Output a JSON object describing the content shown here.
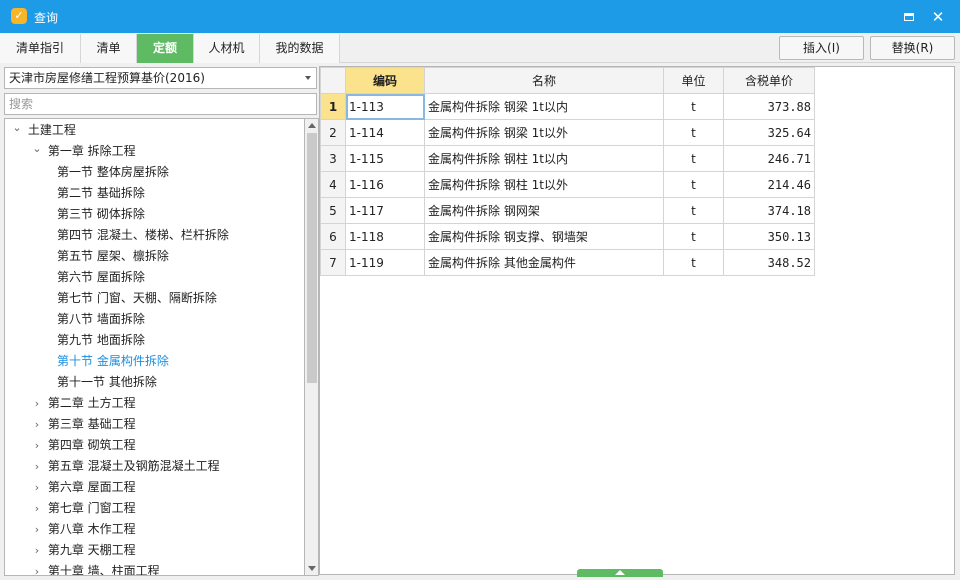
{
  "window": {
    "title": "查询"
  },
  "tabs": [
    {
      "label": "清单指引"
    },
    {
      "label": "清单"
    },
    {
      "label": "定额"
    },
    {
      "label": "人材机"
    },
    {
      "label": "我的数据"
    }
  ],
  "actions": {
    "insert": "插入(I)",
    "replace": "替换(R)"
  },
  "library": {
    "selected": "天津市房屋修缮工程预算基价(2016)"
  },
  "search": {
    "placeholder": "搜索",
    "value": ""
  },
  "tree": [
    {
      "label": "土建工程",
      "level": 0,
      "expander": "open"
    },
    {
      "label": "第一章 拆除工程",
      "level": 1,
      "expander": "open"
    },
    {
      "label": "第一节 整体房屋拆除",
      "level": 2
    },
    {
      "label": "第二节 基础拆除",
      "level": 2
    },
    {
      "label": "第三节 砌体拆除",
      "level": 2
    },
    {
      "label": "第四节 混凝土、楼梯、栏杆拆除",
      "level": 2
    },
    {
      "label": "第五节 屋架、檩拆除",
      "level": 2
    },
    {
      "label": "第六节 屋面拆除",
      "level": 2
    },
    {
      "label": "第七节 门窗、天棚、隔断拆除",
      "level": 2
    },
    {
      "label": "第八节 墙面拆除",
      "level": 2
    },
    {
      "label": "第九节 地面拆除",
      "level": 2
    },
    {
      "label": "第十节 金属构件拆除",
      "level": 2,
      "selected": true
    },
    {
      "label": "第十一节 其他拆除",
      "level": 2
    },
    {
      "label": "第二章 土方工程",
      "level": 1,
      "expander": "closed"
    },
    {
      "label": "第三章 基础工程",
      "level": 1,
      "expander": "closed"
    },
    {
      "label": "第四章 砌筑工程",
      "level": 1,
      "expander": "closed"
    },
    {
      "label": "第五章 混凝土及钢筋混凝土工程",
      "level": 1,
      "expander": "closed"
    },
    {
      "label": "第六章 屋面工程",
      "level": 1,
      "expander": "closed"
    },
    {
      "label": "第七章 门窗工程",
      "level": 1,
      "expander": "closed"
    },
    {
      "label": "第八章 木作工程",
      "level": 1,
      "expander": "closed"
    },
    {
      "label": "第九章 天棚工程",
      "level": 1,
      "expander": "closed"
    },
    {
      "label": "第十章 墙、柱面工程",
      "level": 1,
      "expander": "closed"
    }
  ],
  "grid": {
    "columns": [
      "编码",
      "名称",
      "单位",
      "含税单价"
    ],
    "rows": [
      {
        "no": "1",
        "code": "1-113",
        "name": "金属构件拆除 钢梁 1t以内",
        "unit": "t",
        "price": "373.88"
      },
      {
        "no": "2",
        "code": "1-114",
        "name": "金属构件拆除 钢梁 1t以外",
        "unit": "t",
        "price": "325.64"
      },
      {
        "no": "3",
        "code": "1-115",
        "name": "金属构件拆除 钢柱 1t以内",
        "unit": "t",
        "price": "246.71"
      },
      {
        "no": "4",
        "code": "1-116",
        "name": "金属构件拆除 钢柱 1t以外",
        "unit": "t",
        "price": "214.46"
      },
      {
        "no": "5",
        "code": "1-117",
        "name": "金属构件拆除 钢网架",
        "unit": "t",
        "price": "374.18"
      },
      {
        "no": "6",
        "code": "1-118",
        "name": "金属构件拆除 钢支撑、钢墙架",
        "unit": "t",
        "price": "350.13"
      },
      {
        "no": "7",
        "code": "1-119",
        "name": "金属构件拆除 其他金属构件",
        "unit": "t",
        "price": "348.52"
      }
    ]
  }
}
